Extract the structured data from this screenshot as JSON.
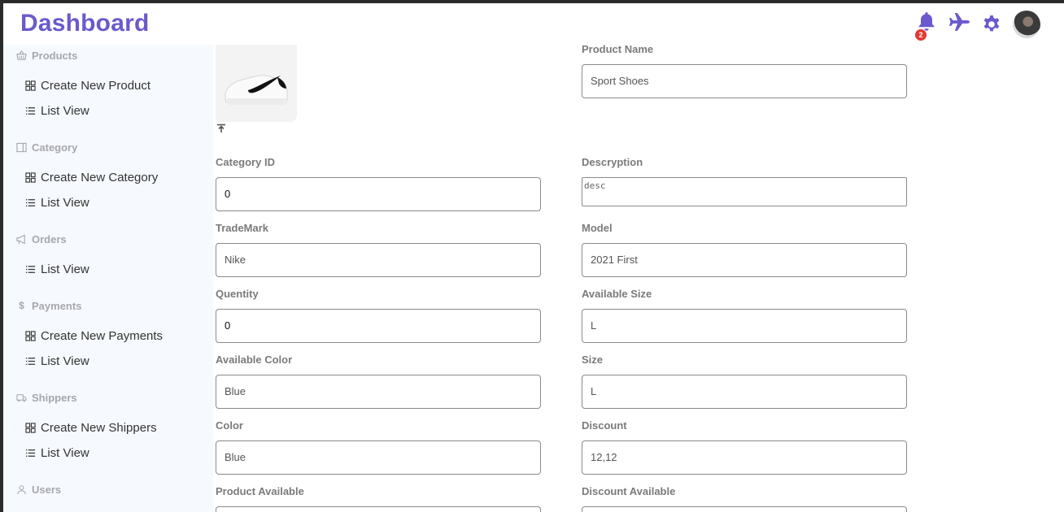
{
  "header": {
    "title": "Dashboard",
    "notification_count": "2"
  },
  "icons": {
    "bell": "bell-icon",
    "plane": "plane-icon",
    "settings": "gear-icon",
    "avatar": "user-avatar"
  },
  "colors": {
    "brand": "#6a5acd",
    "badge": "#e53935",
    "sidebar_bg": "#f6f9fd"
  },
  "sidebar": {
    "sections": [
      {
        "title": "Products",
        "icon": "basket-icon",
        "items": [
          {
            "label": "Create New Product",
            "icon": "grid-icon"
          },
          {
            "label": "List View",
            "icon": "list-icon"
          }
        ]
      },
      {
        "title": "Category",
        "icon": "sidebar-icon",
        "items": [
          {
            "label": "Create New Category",
            "icon": "grid-icon"
          },
          {
            "label": "List View",
            "icon": "list-icon"
          }
        ]
      },
      {
        "title": "Orders",
        "icon": "megaphone-icon",
        "items": [
          {
            "label": "List View",
            "icon": "list-icon"
          }
        ]
      },
      {
        "title": "Payments",
        "icon": "dollar-icon",
        "items": [
          {
            "label": "Create New Payments",
            "icon": "grid-icon"
          },
          {
            "label": "List View",
            "icon": "list-icon"
          }
        ]
      },
      {
        "title": "Shippers",
        "icon": "truck-icon",
        "items": [
          {
            "label": "Create New Shippers",
            "icon": "grid-icon"
          },
          {
            "label": "List View",
            "icon": "list-icon"
          }
        ]
      },
      {
        "title": "Users",
        "icon": "user-icon",
        "items": []
      }
    ]
  },
  "form": {
    "product_name": {
      "label": "Product Name",
      "value": "Sport Shoes"
    },
    "category_id": {
      "label": "Category ID",
      "value": "0"
    },
    "description": {
      "label": "Descryption",
      "value": "desc"
    },
    "trademark": {
      "label": "TradeMark",
      "value": "Nike"
    },
    "model": {
      "label": "Model",
      "value": "2021 First"
    },
    "quantity": {
      "label": "Quentity",
      "value": "0"
    },
    "available_size": {
      "label": "Available Size",
      "value": "L"
    },
    "available_color": {
      "label": "Available Color",
      "value": "Blue"
    },
    "size": {
      "label": "Size",
      "value": "L"
    },
    "color": {
      "label": "Color",
      "value": "Blue"
    },
    "discount": {
      "label": "Discount",
      "value": "12,12"
    },
    "product_available": {
      "label": "Product Available",
      "value": ""
    },
    "discount_available": {
      "label": "Discount Available",
      "value": ""
    }
  }
}
